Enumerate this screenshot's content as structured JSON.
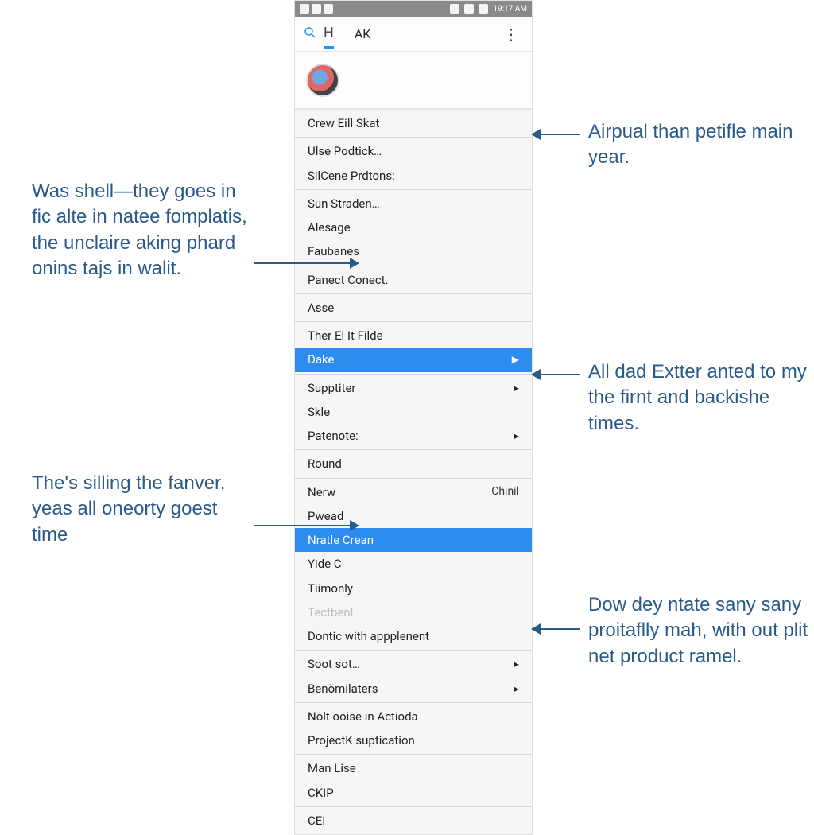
{
  "statusbar": {
    "time": "19:17 AM"
  },
  "toolbar": {
    "title_letter": "H",
    "first_menu_label": "AK"
  },
  "menu": {
    "items": [
      {
        "label": "Crew Eill Skat"
      },
      {
        "label": "Ulse Podtick…"
      },
      {
        "label": "SilCene Prdtons:"
      },
      {
        "label": "Sun Straden…"
      },
      {
        "label": "Alesage"
      },
      {
        "label": "Faubanes"
      },
      {
        "label": "Panect Conect."
      },
      {
        "label": "Asse"
      },
      {
        "label": "Ther El It Filde"
      },
      {
        "label": "Dake",
        "selected": true,
        "arrow": true
      },
      {
        "label": "Supptiter",
        "arrow": true
      },
      {
        "label": "Skle"
      },
      {
        "label": "Patenote:",
        "arrow": true
      },
      {
        "label": "Round"
      },
      {
        "label": "Nerw",
        "rhs": "Chinil"
      },
      {
        "label": "Pwead"
      },
      {
        "label": "Nratle Crean",
        "selected": true
      },
      {
        "label": "Yide C"
      },
      {
        "label": "Tiimonly"
      },
      {
        "label": "Tectbenl",
        "disabled": true
      },
      {
        "label": "Dontic with appplenent"
      },
      {
        "label": "Soot sot…",
        "arrow": true
      },
      {
        "label": "Benömilaters",
        "arrow": true
      },
      {
        "label": "Nolt ooise in Actioda"
      },
      {
        "label": "ProjectK suptication"
      },
      {
        "label": "Man Lise"
      },
      {
        "label": "CKIP"
      },
      {
        "label": "CEI"
      }
    ]
  },
  "annotations": {
    "a1": "Was shell—they goes in fic alte in natee fomplatis, the unclaire aking phard onins tajs in walit.",
    "a2": "The's silling the fanver, yeas all oneorty goest time",
    "a3": "Airpual than petifle main year.",
    "a4": "All dad Extter anted to my the firnt and backishe times.",
    "a5": "Dow dey ntate sany sany proitaflly mah, with out plit net product ramel."
  }
}
